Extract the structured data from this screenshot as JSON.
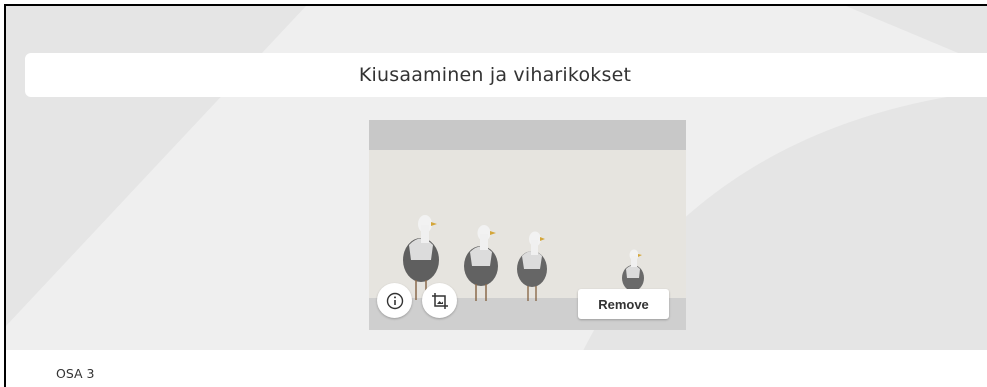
{
  "header": {
    "title": "Kiusaaminen ja viharikokset"
  },
  "image": {
    "subject": "seagulls",
    "actions": {
      "info_icon": "info-icon",
      "crop_icon": "crop-icon",
      "remove_label": "Remove"
    }
  },
  "section": {
    "label": "OSA 3"
  },
  "colors": {
    "background": "#efefef",
    "panel": "#ffffff",
    "text": "#333333",
    "decor_shape": "#e4e4e4"
  }
}
